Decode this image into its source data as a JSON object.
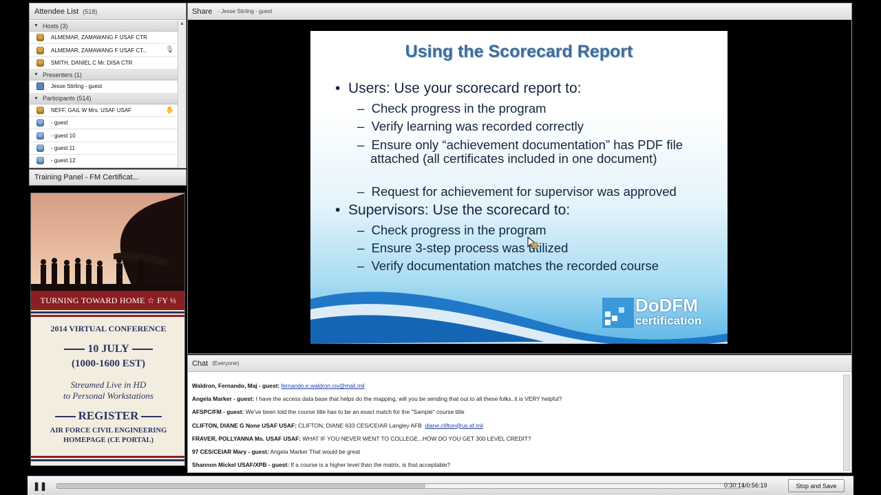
{
  "attendee_pod": {
    "title": "Attendee List",
    "count": "(518)",
    "groups": {
      "hosts": {
        "label": "Hosts (3)",
        "members": [
          {
            "name": "ALMEMAR, ZAMAWANG F USAF CTR",
            "icon": "host-icon"
          },
          {
            "name": "ALMEMAR, ZAMAWANG F USAF CT...",
            "icon": "host-icon",
            "badge": "microphone-icon"
          },
          {
            "name": "SMITH, DANIEL C Mr. DISA CTR",
            "icon": "host-icon"
          }
        ]
      },
      "presenters": {
        "label": "Presenters (1)",
        "members": [
          {
            "name": "Jesse Stirling - guest",
            "icon": "presenter-icon"
          }
        ]
      },
      "participants": {
        "label": "Participants (514)",
        "members": [
          {
            "name": "NEFF, GAIL W Mrs. USAF USAF",
            "icon": "participant-icon",
            "badge": "raise-hand-icon"
          },
          {
            "name": "- guest",
            "icon": "participant-icon"
          },
          {
            "name": "- guest 10",
            "icon": "participant-icon"
          },
          {
            "name": "- guest 11",
            "icon": "participant-icon"
          },
          {
            "name": "- guest 12",
            "icon": "participant-icon"
          }
        ]
      }
    }
  },
  "training_pod": {
    "title": "Training Panel - FM Certificat..."
  },
  "poster": {
    "banner": "TURNING TOWARD HOME ☆ FY ⅓",
    "conference": "2014 VIRTUAL CONFERENCE",
    "date": "10 JULY",
    "time": "(1000-1600 EST)",
    "stream_line1": "Streamed Live in HD",
    "stream_line2": "to Personal Workstations",
    "register": "REGISTER",
    "portal_line1": "AIR FORCE CIVIL ENGINEERING",
    "portal_line2": "HOMEPAGE (CE PORTAL)",
    "colors": {
      "red": "#8b1e22",
      "navy": "#2a3561"
    }
  },
  "share_pod": {
    "title": "Share",
    "presenter": "- Jesse Stirling - guest"
  },
  "slide": {
    "title": "Using the Scorecard Report",
    "bullet_users": "Users:  Use your scorecard report to:",
    "users_items": [
      "Check progress in the program",
      "Verify learning was recorded correctly",
      "Ensure only “achievement documentation” has PDF file attached (all certificates included in one document)",
      "Request for achievement for supervisor was approved"
    ],
    "bullet_supervisors": "Supervisors: Use the scorecard to:",
    "supervisor_items": [
      "Check progress in the program",
      "Ensure 3-step process was utilized",
      "Verify documentation matches the recorded course"
    ],
    "logo_main": "DoDFM",
    "logo_sub": "certification",
    "colors": {
      "title": "#3e6d9e",
      "text": "#152540",
      "wave": "#1f79c8"
    }
  },
  "chat_pod": {
    "title": "Chat",
    "scope": "(Everyone)",
    "messages": [
      {
        "sender": "Waldron, Fernando, Maj - guest:",
        "text": "",
        "link": "fernando.e.waldron.civ@mail.mil"
      },
      {
        "sender": "Angela Marker - guest:",
        "text": "I have the access data base that helps do the mapping, will you be sending that out to all these folks..it is VERY helpful?",
        "link": ""
      },
      {
        "sender": "AFSPC/FM - guest:",
        "text": "We've been told the course title has to be an exact match for the \"Sample\" course title",
        "link": ""
      },
      {
        "sender": "CLIFTON, DIANE G None USAF USAF:",
        "text": "CLIFTON, DIANE 633 CES/CEIAR Langley AFB",
        "link": "diane.clifton@us.af.mil"
      },
      {
        "sender": "FRAVER, POLLYANNA Ms. USAF USAF:",
        "text": "WHAT IF YOU NEVER WENT TO COLLEGE...HOW DO YOU GET 300 LEVEL CREDIT?",
        "link": ""
      },
      {
        "sender": "97 CES/CEIAR  Mary  - guest:",
        "text": "Angela Marker That would be great",
        "link": ""
      },
      {
        "sender": "Shannon Mickel USAF/XPB - guest:",
        "text": "If a course is a higher level than the matrix, is that acceptable?",
        "link": ""
      }
    ]
  },
  "player": {
    "pause_icon": "pause-icon",
    "time": "0:30:14/0:56:19",
    "progress": 0.537,
    "stop_save_label": "Stop and Save"
  }
}
